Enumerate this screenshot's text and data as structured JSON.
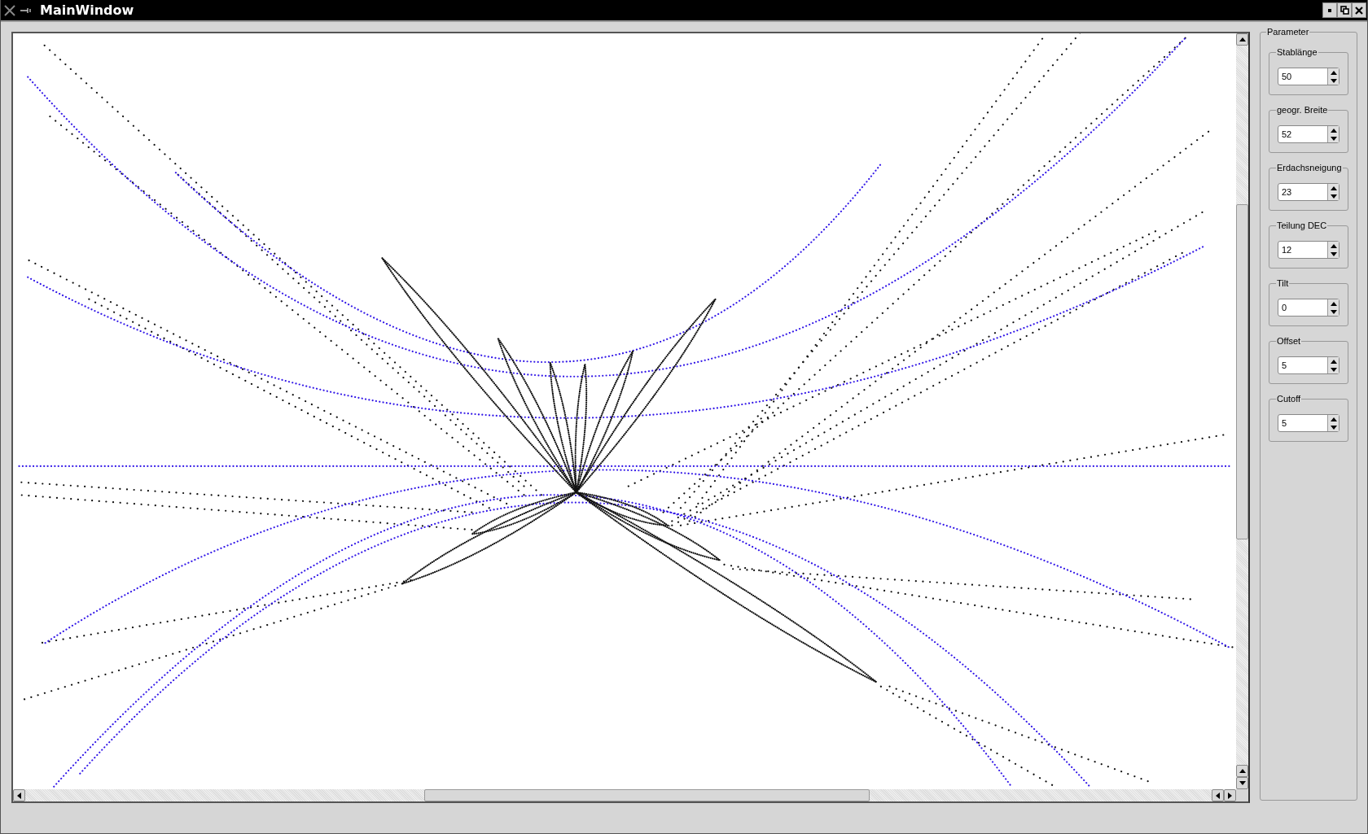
{
  "window": {
    "title": "MainWindow"
  },
  "panel": {
    "title": "Parameter",
    "fields": [
      {
        "label": "Stablänge",
        "value": "50"
      },
      {
        "label": "geogr. Breite",
        "value": "52"
      },
      {
        "label": "Erdachsneigung",
        "value": "23"
      },
      {
        "label": "Teilung DEC",
        "value": "12"
      },
      {
        "label": "Tilt",
        "value": "0"
      },
      {
        "label": "Offset",
        "value": "5"
      },
      {
        "label": "Cutoff",
        "value": "5"
      }
    ]
  }
}
